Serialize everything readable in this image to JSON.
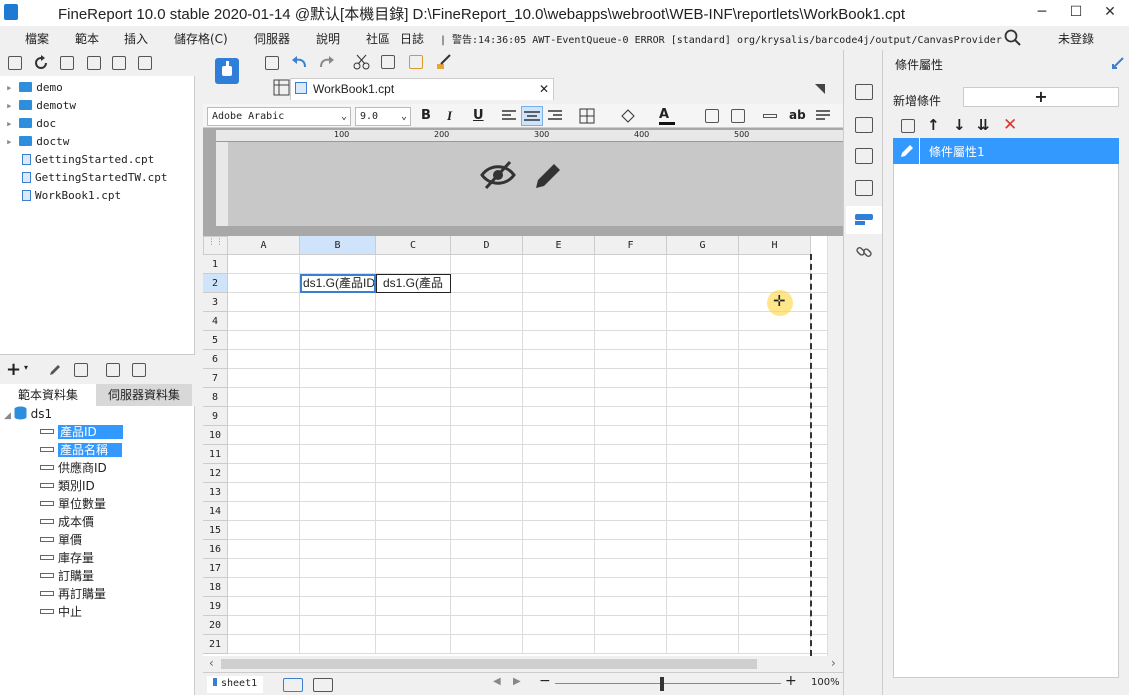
{
  "window": {
    "title": "FineReport 10.0 stable 2020-01-14 @默认[本機目錄]    D:\\FineReport_10.0\\webapps\\webroot\\WEB-INF\\reportlets\\WorkBook1.cpt",
    "minimize": "─",
    "maximize": "☐",
    "close": "✕"
  },
  "menu": {
    "items": [
      "檔案",
      "範本",
      "插入",
      "儲存格(C)",
      "伺服器",
      "說明",
      "社區",
      "日誌"
    ],
    "error_log": "| 警告:14:36:05 AWT-EventQueue-0 ERROR [standard] org/krysalis/barcode4j/output/CanvasProvider",
    "login": "未登錄"
  },
  "filetree": {
    "items": [
      {
        "label": "demo",
        "type": "folder"
      },
      {
        "label": "demotw",
        "type": "folder"
      },
      {
        "label": "doc",
        "type": "folder"
      },
      {
        "label": "doctw",
        "type": "folder"
      },
      {
        "label": "GettingStarted.cpt",
        "type": "file"
      },
      {
        "label": "GettingStartedTW.cpt",
        "type": "file"
      },
      {
        "label": "WorkBook1.cpt",
        "type": "file"
      }
    ]
  },
  "datasets": {
    "tabs": [
      "範本資料集",
      "伺服器資料集"
    ],
    "root": "ds1",
    "fields": [
      "產品ID",
      "產品名稱",
      "供應商ID",
      "類別ID",
      "單位數量",
      "成本價",
      "單價",
      "庫存量",
      "訂購量",
      "再訂購量",
      "中止"
    ]
  },
  "editor": {
    "tab_label": "WorkBook1.cpt",
    "tab_close": "✕",
    "font_family": "Adobe Arabic",
    "font_size": "9.0",
    "ruler_labels": [
      "100",
      "200",
      "300",
      "400",
      "500"
    ],
    "columns": [
      "A",
      "B",
      "C",
      "D",
      "E",
      "F",
      "G",
      "H"
    ],
    "rows": [
      "1",
      "2",
      "3",
      "4",
      "5",
      "6",
      "7",
      "8",
      "9",
      "10",
      "11",
      "12",
      "13",
      "14",
      "15",
      "16",
      "17",
      "18",
      "19",
      "20",
      "21"
    ],
    "cell_b2": "ds1.G(產品ID",
    "cell_c2": "ds1.G(產品",
    "sheet_tab": "sheet1",
    "zoom": "100%"
  },
  "right_panel": {
    "title": "條件屬性",
    "new_condition_label": "新增條件",
    "add_symbol": "+",
    "conditions": [
      "條件屬性1"
    ]
  },
  "colors": {
    "accent": "#3399ff",
    "logo": "#1e7ad2",
    "delete": "#d9362f"
  }
}
